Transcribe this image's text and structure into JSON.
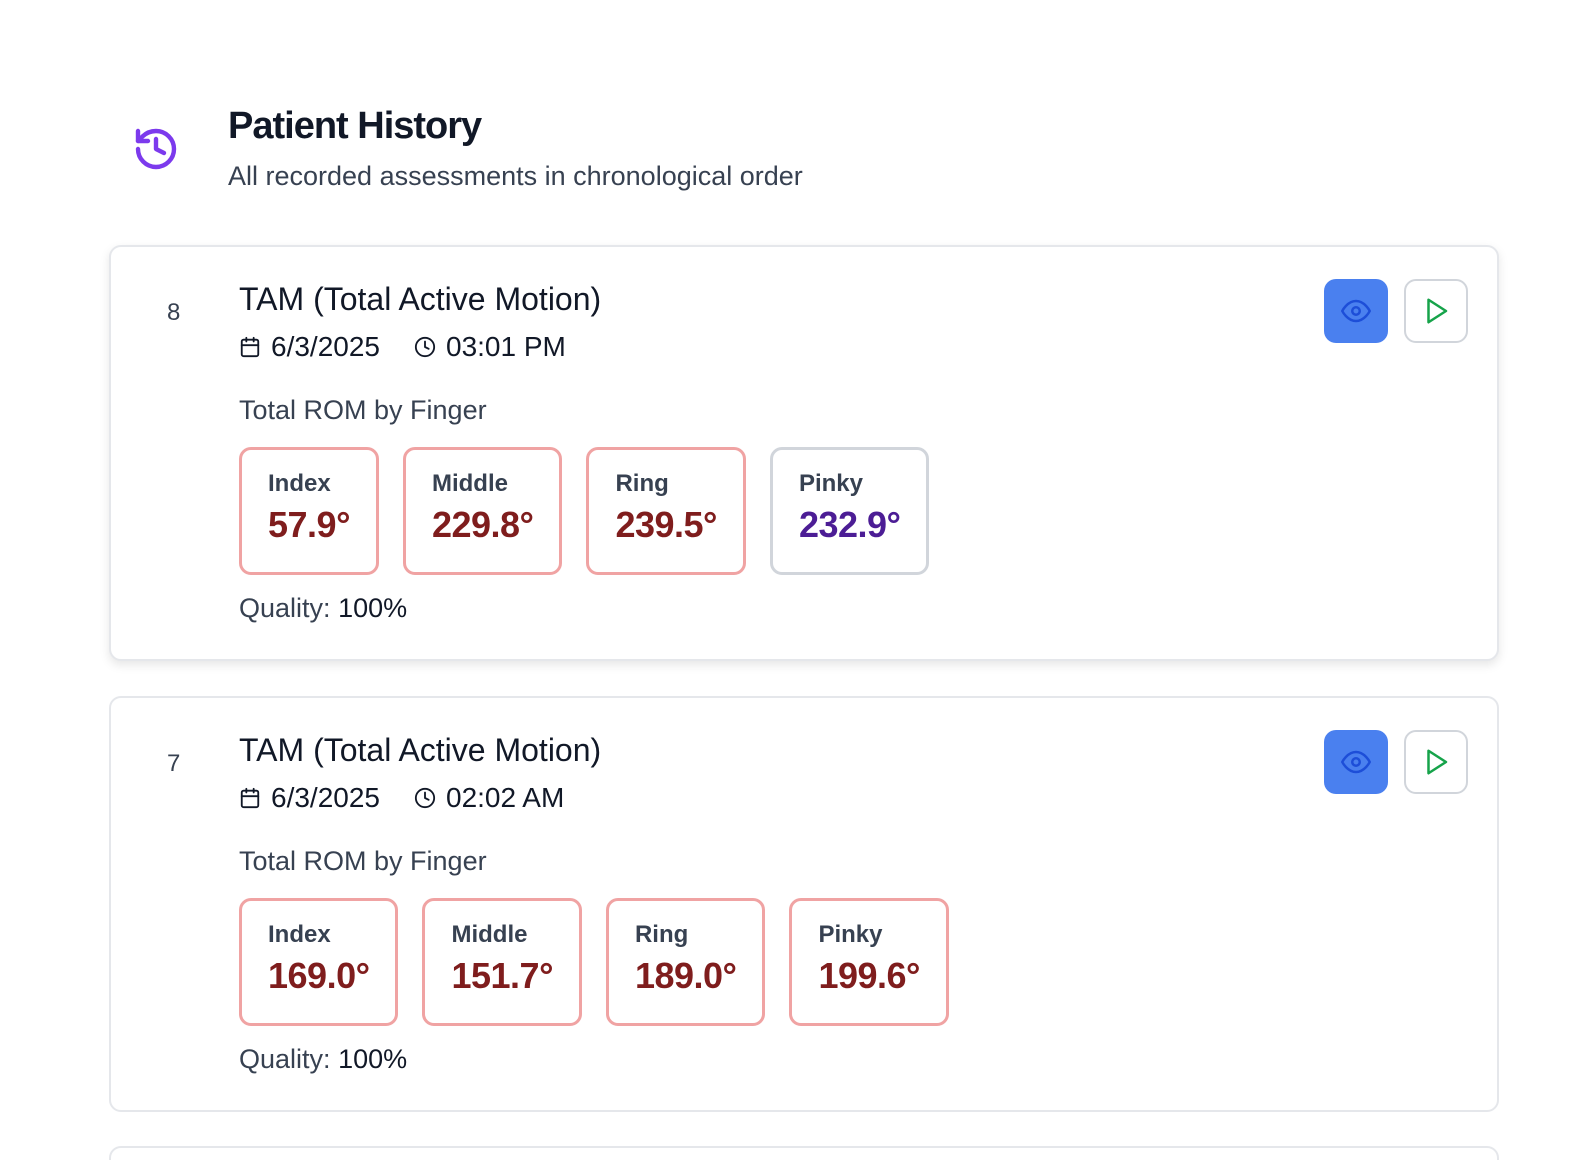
{
  "header": {
    "title": "Patient History",
    "subtitle": "All recorded assessments in chronological order",
    "icon": "history-icon",
    "icon_color": "#7c3aed"
  },
  "colors": {
    "view_button": "#4a80ef",
    "play_icon": "#16a34a",
    "finger_border_alert": "#f0a3a3",
    "finger_value_alert": "#7f1d1d",
    "finger_value_normal": "#4c1d95"
  },
  "assessments": [
    {
      "number": "8",
      "title": "TAM (Total Active Motion)",
      "date": "6/3/2025",
      "time": "03:01 PM",
      "rom_label": "Total ROM by Finger",
      "fingers": [
        {
          "name": "Index",
          "value": "57.9°"
        },
        {
          "name": "Middle",
          "value": "229.8°"
        },
        {
          "name": "Ring",
          "value": "239.5°"
        },
        {
          "name": "Pinky",
          "value": "232.9°"
        }
      ],
      "quality_label": "Quality:",
      "quality_value": "100%"
    },
    {
      "number": "7",
      "title": "TAM (Total Active Motion)",
      "date": "6/3/2025",
      "time": "02:02 AM",
      "rom_label": "Total ROM by Finger",
      "fingers": [
        {
          "name": "Index",
          "value": "169.0°"
        },
        {
          "name": "Middle",
          "value": "151.7°"
        },
        {
          "name": "Ring",
          "value": "189.0°"
        },
        {
          "name": "Pinky",
          "value": "199.6°"
        }
      ],
      "quality_label": "Quality:",
      "quality_value": "100%"
    }
  ]
}
